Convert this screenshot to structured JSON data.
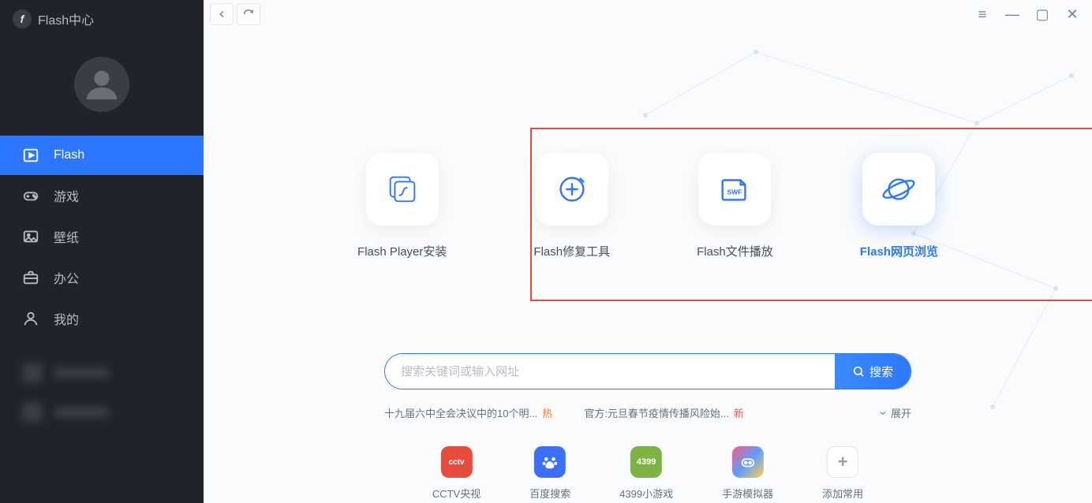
{
  "app": {
    "title": "Flash中心",
    "logo_glyph": "f"
  },
  "sidebar": {
    "items": [
      {
        "label": "Flash",
        "icon": "play-box-icon",
        "active": true
      },
      {
        "label": "游戏",
        "icon": "gamepad-icon"
      },
      {
        "label": "壁纸",
        "icon": "picture-icon"
      },
      {
        "label": "办公",
        "icon": "briefcase-icon"
      },
      {
        "label": "我的",
        "icon": "user-icon"
      }
    ]
  },
  "tiles": [
    {
      "label": "Flash Player安装",
      "icon": "flash-install-icon"
    },
    {
      "label": "Flash修复工具",
      "icon": "flash-repair-icon"
    },
    {
      "label": "Flash文件播放",
      "icon": "swf-file-icon"
    },
    {
      "label": "Flash网页浏览",
      "icon": "planet-browser-icon",
      "selected": true
    }
  ],
  "search": {
    "placeholder": "搜索关键词或输入网址",
    "button": "搜索"
  },
  "news": {
    "items": [
      {
        "text": "十九届六中全会决议中的10个明...",
        "tag": "热"
      },
      {
        "text": "官方:元旦春节疫情传播风险始...",
        "tag": "新"
      }
    ],
    "expand": "展开"
  },
  "quick": [
    {
      "label": "CCTV央视",
      "code": "cctv",
      "glyph": "cctv"
    },
    {
      "label": "百度搜索",
      "code": "baidu",
      "glyph": ""
    },
    {
      "label": "4399小游戏",
      "code": "g4399",
      "glyph": "4399"
    },
    {
      "label": "手游模拟器",
      "code": "sim",
      "glyph": ""
    },
    {
      "label": "添加常用",
      "code": "plus",
      "glyph": "+"
    }
  ]
}
